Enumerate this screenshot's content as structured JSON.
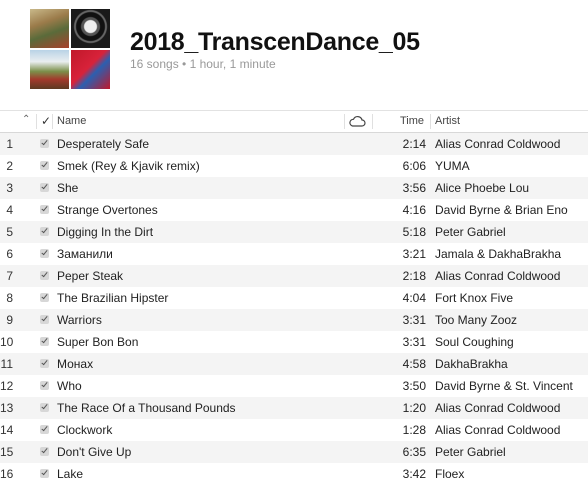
{
  "playlist": {
    "title": "2018_TranscenDance_05",
    "subtitle": "16 songs • 1 hour, 1 minute"
  },
  "columns": {
    "name": "Name",
    "time": "Time",
    "artist": "Artist"
  },
  "icons": {
    "sort": "chevron-up-icon",
    "checked": "checkmark-icon",
    "cloud": "cloud-icon"
  },
  "tracks": [
    {
      "num": "1",
      "name": "Desperately Safe",
      "time": "2:14",
      "artist": "Alias Conrad Coldwood"
    },
    {
      "num": "2",
      "name": "Smek (Rey & Kjavik remix)",
      "time": "6:06",
      "artist": "YUMA"
    },
    {
      "num": "3",
      "name": "She",
      "time": "3:56",
      "artist": "Alice Phoebe Lou"
    },
    {
      "num": "4",
      "name": "Strange Overtones",
      "time": "4:16",
      "artist": "David Byrne & Brian Eno"
    },
    {
      "num": "5",
      "name": "Digging In the Dirt",
      "time": "5:18",
      "artist": "Peter Gabriel"
    },
    {
      "num": "6",
      "name": "Заманили",
      "time": "3:21",
      "artist": "Jamala & DakhaBrakha"
    },
    {
      "num": "7",
      "name": "Peper Steak",
      "time": "2:18",
      "artist": "Alias Conrad Coldwood"
    },
    {
      "num": "8",
      "name": "The Brazilian Hipster",
      "time": "4:04",
      "artist": "Fort Knox Five"
    },
    {
      "num": "9",
      "name": "Warriors",
      "time": "3:31",
      "artist": "Too Many Zooz"
    },
    {
      "num": "10",
      "name": "Super Bon Bon",
      "time": "3:31",
      "artist": "Soul Coughing"
    },
    {
      "num": "11",
      "name": "Монах",
      "time": "4:58",
      "artist": "DakhaBrakha"
    },
    {
      "num": "12",
      "name": "Who",
      "time": "3:50",
      "artist": "David Byrne & St. Vincent"
    },
    {
      "num": "13",
      "name": "The Race Of a Thousand Pounds",
      "time": "1:20",
      "artist": "Alias Conrad Coldwood"
    },
    {
      "num": "14",
      "name": "Clockwork",
      "time": "1:28",
      "artist": "Alias Conrad Coldwood"
    },
    {
      "num": "15",
      "name": "Don't Give Up",
      "time": "6:35",
      "artist": "Peter Gabriel"
    },
    {
      "num": "16",
      "name": "Lake",
      "time": "3:42",
      "artist": "Floex"
    }
  ]
}
